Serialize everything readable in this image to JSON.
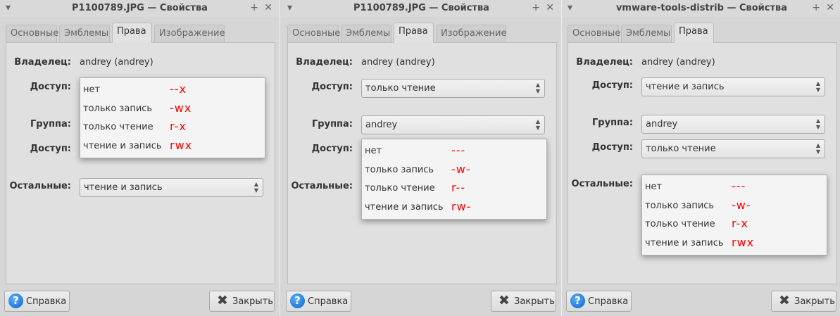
{
  "windows": [
    {
      "title": "P1100789.JPG — Свойства",
      "tabs": [
        "Основные",
        "Эмблемы",
        "Права",
        "Изображение"
      ],
      "active_tab": 2,
      "owner_label": "Владелец:",
      "owner": "andrey (andrey)",
      "access_label": "Доступ:",
      "group_label": "Группа:",
      "access2_label": "Доступ:",
      "others_label": "Остальные:",
      "access_value": null,
      "group_value": null,
      "access2_value": null,
      "others_value": "чтение и запись",
      "popup": {
        "items": [
          {
            "label": "нет",
            "perm": "--x"
          },
          {
            "label": "только запись",
            "perm": "-wx"
          },
          {
            "label": "только чтение",
            "perm": "r-x"
          },
          {
            "label": "чтение и запись",
            "perm": "rwx"
          }
        ]
      },
      "help": "Справка",
      "close": "Закрыть"
    },
    {
      "title": "P1100789.JPG — Свойства",
      "tabs": [
        "Основные",
        "Эмблемы",
        "Права",
        "Изображение"
      ],
      "active_tab": 2,
      "owner_label": "Владелец:",
      "owner": "andrey (andrey)",
      "access_label": "Доступ:",
      "group_label": "Группа:",
      "access2_label": "Доступ:",
      "others_label": "Остальные:",
      "access_value": "только чтение",
      "group_value": "andrey",
      "access2_value": null,
      "others_value": null,
      "popup": {
        "items": [
          {
            "label": "нет",
            "perm": "---"
          },
          {
            "label": "только запись",
            "perm": "-w-"
          },
          {
            "label": "только чтение",
            "perm": "r--"
          },
          {
            "label": "чтение и запись",
            "perm": "rw-"
          }
        ]
      },
      "help": "Справка",
      "close": "Закрыть"
    },
    {
      "title": "vmware-tools-distrib — Свойства",
      "tabs": [
        "Основные",
        "Эмблемы",
        "Права"
      ],
      "active_tab": 2,
      "owner_label": "Владелец:",
      "owner": "andrey (andrey)",
      "access_label": "Доступ:",
      "group_label": "Группа:",
      "access2_label": "Доступ:",
      "others_label": "Остальные:",
      "access_value": "чтение и запись",
      "group_value": "andrey",
      "access2_value": "только чтение",
      "others_value": null,
      "popup": {
        "items": [
          {
            "label": "нет",
            "perm": "---"
          },
          {
            "label": "только запись",
            "perm": "-w-"
          },
          {
            "label": "только чтение",
            "perm": "r-x"
          },
          {
            "label": "чтение и запись",
            "perm": "rwx"
          }
        ]
      },
      "help": "Справка",
      "close": "Закрыть"
    }
  ]
}
